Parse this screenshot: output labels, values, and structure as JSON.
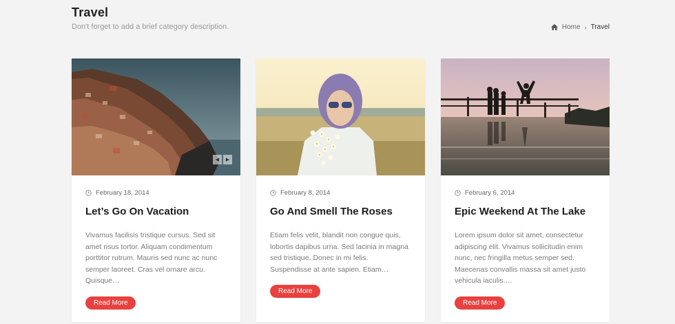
{
  "header": {
    "title": "Travel",
    "description": "Don't forget to add a brief category description."
  },
  "breadcrumb": {
    "home": "Home",
    "separator": "›",
    "current": "Travel"
  },
  "colors": {
    "accent": "#e8413f",
    "background": "#f3f3f3"
  },
  "slider": {
    "prev": "◀",
    "next": "▶"
  },
  "posts": [
    {
      "date": "February 18, 2014",
      "title": "Let’s Go On Vacation",
      "excerpt": "Vivamus facilisis tristique cursus. Sed sit amet risus tortor. Aliquam condimentum porttitor rutrum. Mauris sed nunc ac nunc semper laoreet. Cras vel ornare arcu. Quisque…",
      "button": "Read More"
    },
    {
      "date": "February 8, 2014",
      "title": "Go And Smell The Roses",
      "excerpt": "Etiam felis velit, blandit non congue quis, lobortis dapibus urna. Sed lacinia in magna sed tristique. Donec in mi felis. Suspendisse at ante sapien. Etiam…",
      "button": "Read More"
    },
    {
      "date": "February 6, 2014",
      "title": "Epic Weekend At The Lake",
      "excerpt": "Lorem ipsum dolor sit amet, consectetur adipiscing elit. Vivamus sollicitudin enim nunc, nec fringilla metus semper sed. Maecenas convallis massa sit amet justo vehicula iaculis.…",
      "button": "Read More"
    }
  ]
}
